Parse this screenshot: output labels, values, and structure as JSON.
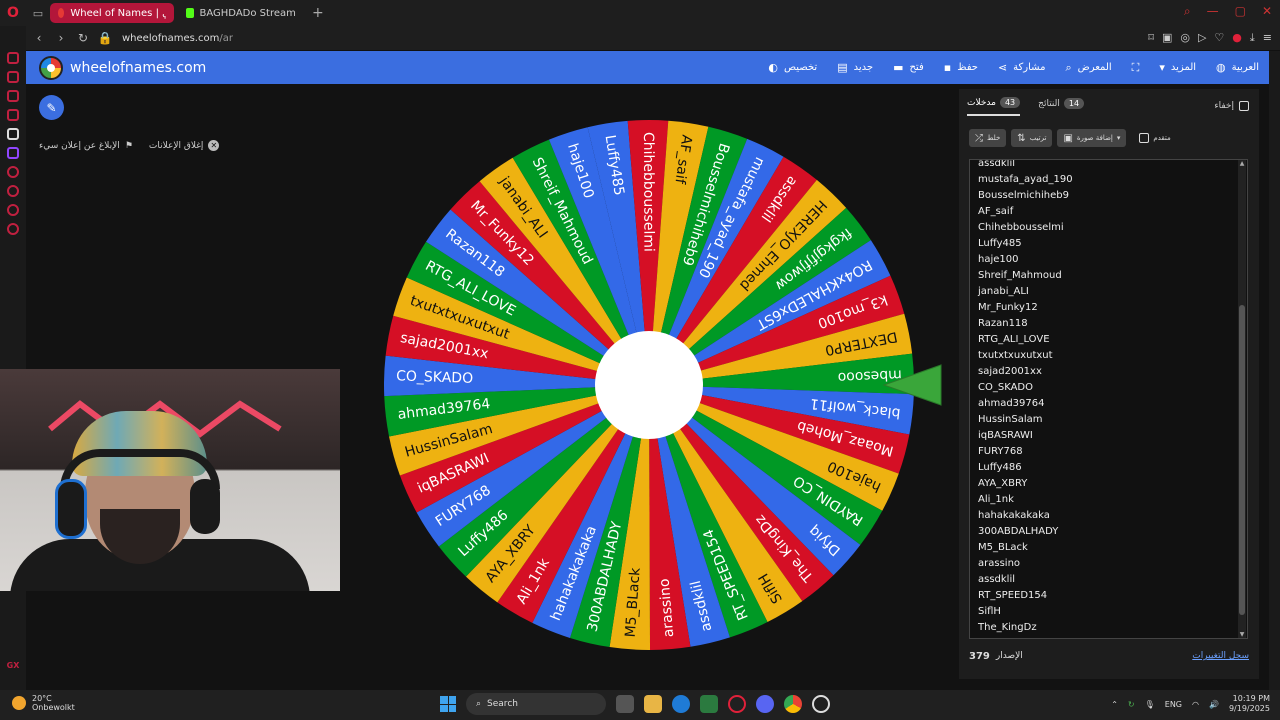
{
  "browser": {
    "tabs": [
      {
        "label": "Wheel of Names | عجلة عشوائي",
        "color": "#e53935"
      },
      {
        "label": "BAGHDADo Stream - Watc",
        "color": "#53fc18"
      }
    ],
    "url_host": "wheelofnames.com",
    "url_path": "/ar"
  },
  "app": {
    "brand": "wheelofnames.com",
    "menu": [
      {
        "label": "تخصيص",
        "icon": "palette-icon"
      },
      {
        "label": "جديد",
        "icon": "file-icon"
      },
      {
        "label": "فتح",
        "icon": "folder-icon"
      },
      {
        "label": "حفظ",
        "icon": "save-icon"
      },
      {
        "label": "مشاركة",
        "icon": "share-icon"
      },
      {
        "label": "المعرض",
        "icon": "search-icon"
      },
      {
        "label": "",
        "icon": "fullscreen-icon"
      },
      {
        "label": "المزيد",
        "icon": "caret-down-icon"
      },
      {
        "label": "العربية",
        "icon": "globe-icon"
      }
    ]
  },
  "ads": {
    "report": "الإبلاغ عن إعلان سيء",
    "close": "إغلاق الإعلانات"
  },
  "wheel": {
    "colors": [
      "#3369e8",
      "#d50f25",
      "#eeb211",
      "#009925"
    ],
    "entries": [
      "Luffy485",
      "Chihebbousselmi",
      "AF_saif",
      "Bousselmichiheb9",
      "mustafa_ayad_190",
      "assdklil",
      "HEREXJO_Ehmed",
      "fkgkgjfjfjwow",
      "RO4xKHALEDx6ST",
      "k3_mo100",
      "DEXTERP0",
      "mbesooo",
      "black_wolf11",
      "Moaaz_Moheb",
      "haje100",
      "RAYDIN_CO",
      "Dfyiq",
      "The_KingDz",
      "SiflH",
      "RT_SPEED154",
      "assdklil",
      "arassino",
      "M5_BLack",
      "300ABDALHADY",
      "hahakakakaka",
      "Ali_1nk",
      "AYA_XBRY",
      "Luffy486",
      "FURY768",
      "iqBASRAWI",
      "HussinSalam",
      "ahmad39764",
      "CO_SKADO",
      "sajad2001xx",
      "txutxtxuxutxut",
      "RTG_ALI_LOVE",
      "Razan118",
      "Mr_Funky12",
      "janabi_ALI",
      "Shreif_Mahmoud",
      "haje100"
    ]
  },
  "panel": {
    "tab_entries": "مدخلات",
    "tab_entries_count": "43",
    "tab_results": "النتائج",
    "tab_results_count": "14",
    "hide": "إخفاء",
    "shuffle": "خلط",
    "sort": "ترتيب",
    "add_image": "إضافة صورة",
    "advanced": "متقدم",
    "entries": [
      "assdklil",
      "mustafa_ayad_190",
      "Bousselmichiheb9",
      "AF_saif",
      "Chihebbousselmi",
      "Luffy485",
      "haje100",
      "Shreif_Mahmoud",
      "janabi_ALI",
      "Mr_Funky12",
      "Razan118",
      "RTG_ALI_LOVE",
      "txutxtxuxutxut",
      "sajad2001xx",
      "CO_SKADO",
      "ahmad39764",
      "HussinSalam",
      "iqBASRAWI",
      "FURY768",
      "Luffy486",
      "AYA_XBRY",
      "Ali_1nk",
      "hahakakakaka",
      "300ABDALHADY",
      "M5_BLack",
      "arassino",
      "assdklil",
      "RT_SPEED154",
      "SiflH",
      "The_KingDz"
    ],
    "version_label": "الإصدار",
    "version_number": "379",
    "changelog": "سجل التغييرات"
  },
  "taskbar": {
    "temp": "20°C",
    "weather": "Onbewolkt",
    "search": "Search",
    "lang": "ENG",
    "time": "10:19 PM",
    "date": "9/19/2025"
  }
}
